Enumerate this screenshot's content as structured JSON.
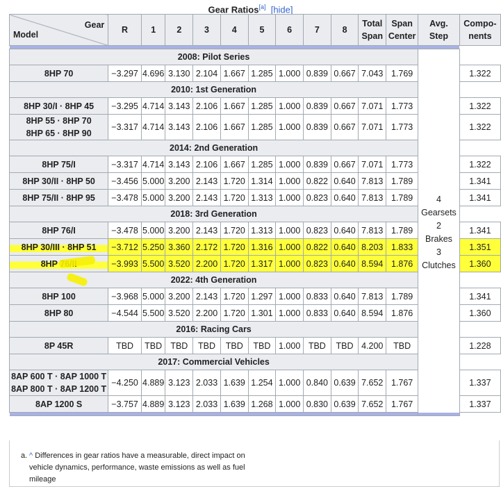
{
  "caption": {
    "title": "Gear Ratios",
    "note_ref": "[a]",
    "hide": "[hide]"
  },
  "header": {
    "gear": "Gear",
    "model": "Model",
    "cols": [
      "R",
      "1",
      "2",
      "3",
      "4",
      "5",
      "6",
      "7",
      "8"
    ],
    "total_span": [
      "Total",
      "Span"
    ],
    "span_center": [
      "Span",
      "Center"
    ],
    "avg_step": [
      "Avg.",
      "Step"
    ],
    "components": [
      "Compo-",
      "nents"
    ]
  },
  "components_text": [
    "4",
    "Gearsets",
    "2",
    "Brakes",
    "3",
    "Clutches"
  ],
  "sections": [
    {
      "title": "2008: Pilot Series",
      "rows": [
        {
          "model": [
            "8HP 70"
          ],
          "values": [
            "−3.297",
            "4.696",
            "3.130",
            "2.104",
            "1.667",
            "1.285",
            "1.000",
            "0.839",
            "0.667",
            "7.043",
            "1.769",
            "1.322"
          ]
        }
      ]
    },
    {
      "title": "2010: 1st Generation",
      "rows": [
        {
          "model": [
            "8HP 30/I · 8HP 45"
          ],
          "values": [
            "−3.295",
            "4.714",
            "3.143",
            "2.106",
            "1.667",
            "1.285",
            "1.000",
            "0.839",
            "0.667",
            "7.071",
            "1.773",
            "1.322"
          ]
        },
        {
          "model": [
            "8HP 55 · 8HP 70",
            "8HP 65 · 8HP 90"
          ],
          "values": [
            "−3.317",
            "4.714",
            "3.143",
            "2.106",
            "1.667",
            "1.285",
            "1.000",
            "0.839",
            "0.667",
            "7.071",
            "1.773",
            "1.322"
          ]
        }
      ]
    },
    {
      "title": "2014: 2nd Generation",
      "rows": [
        {
          "model": [
            "8HP 75/I"
          ],
          "values": [
            "−3.317",
            "4.714",
            "3.143",
            "2.106",
            "1.667",
            "1.285",
            "1.000",
            "0.839",
            "0.667",
            "7.071",
            "1.773",
            "1.322"
          ]
        },
        {
          "model": [
            "8HP 30/II · 8HP 50"
          ],
          "values": [
            "−3.456",
            "5.000",
            "3.200",
            "2.143",
            "1.720",
            "1.314",
            "1.000",
            "0.822",
            "0.640",
            "7.813",
            "1.789",
            "1.341"
          ]
        },
        {
          "model": [
            "8HP 75/II · 8HP 95"
          ],
          "values": [
            "−3.478",
            "5.000",
            "3.200",
            "2.143",
            "1.720",
            "1.313",
            "1.000",
            "0.823",
            "0.640",
            "7.813",
            "1.789",
            "1.341"
          ]
        }
      ]
    },
    {
      "title": "2018: 3rd Generation",
      "rows": [
        {
          "model": [
            "8HP 76/I"
          ],
          "values": [
            "−3.478",
            "5.000",
            "3.200",
            "2.143",
            "1.720",
            "1.313",
            "1.000",
            "0.823",
            "0.640",
            "7.813",
            "1.789",
            "1.341"
          ]
        },
        {
          "model": [
            "8HP 30/III · 8HP 51"
          ],
          "highlight": true,
          "values": [
            "−3.712",
            "5.250",
            "3.360",
            "2.172",
            "1.720",
            "1.316",
            "1.000",
            "0.822",
            "0.640",
            "8.203",
            "1.833",
            "1.351"
          ]
        },
        {
          "model": [
            "8HP 76/II"
          ],
          "highlight": true,
          "values": [
            "−3.993",
            "5.500",
            "3.520",
            "2.200",
            "1.720",
            "1.317",
            "1.000",
            "0.823",
            "0.640",
            "8.594",
            "1.876",
            "1.360"
          ]
        }
      ]
    },
    {
      "title": "2022: 4th Generation",
      "rows": [
        {
          "model": [
            "8HP 100"
          ],
          "values": [
            "−3.968",
            "5.000",
            "3.200",
            "2.143",
            "1.720",
            "1.297",
            "1.000",
            "0.833",
            "0.640",
            "7.813",
            "1.789",
            "1.341"
          ]
        },
        {
          "model": [
            "8HP 80"
          ],
          "values": [
            "−4.544",
            "5.500",
            "3.520",
            "2.200",
            "1.720",
            "1.301",
            "1.000",
            "0.833",
            "0.640",
            "8.594",
            "1.876",
            "1.360"
          ]
        }
      ]
    },
    {
      "title": "2016: Racing Cars",
      "rows": [
        {
          "model": [
            "8P 45R"
          ],
          "values": [
            "TBD",
            "TBD",
            "TBD",
            "TBD",
            "TBD",
            "TBD",
            "1.000",
            "TBD",
            "TBD",
            "4.200",
            "TBD",
            "1.228"
          ]
        }
      ]
    },
    {
      "title": "2017: Commercial Vehicles",
      "rows": [
        {
          "model": [
            "8AP 600 T · 8AP 1000 T",
            "8AP 800 T · 8AP 1200 T"
          ],
          "values": [
            "−4.250",
            "4.889",
            "3.123",
            "2.033",
            "1.639",
            "1.254",
            "1.000",
            "0.840",
            "0.639",
            "7.652",
            "1.767",
            "1.337"
          ]
        },
        {
          "model": [
            "8AP 1200 S"
          ],
          "values": [
            "−3.757",
            "4.889",
            "3.123",
            "2.033",
            "1.639",
            "1.268",
            "1.000",
            "0.830",
            "0.639",
            "7.652",
            "1.767",
            "1.337"
          ]
        }
      ]
    }
  ],
  "footnote": {
    "label": "a.",
    "caret": "^",
    "text": "Differences in gear ratios have a measurable, direct impact on vehicle dynamics, performance, waste emissions as well as fuel mileage"
  },
  "highlight_color": "#ffff00"
}
